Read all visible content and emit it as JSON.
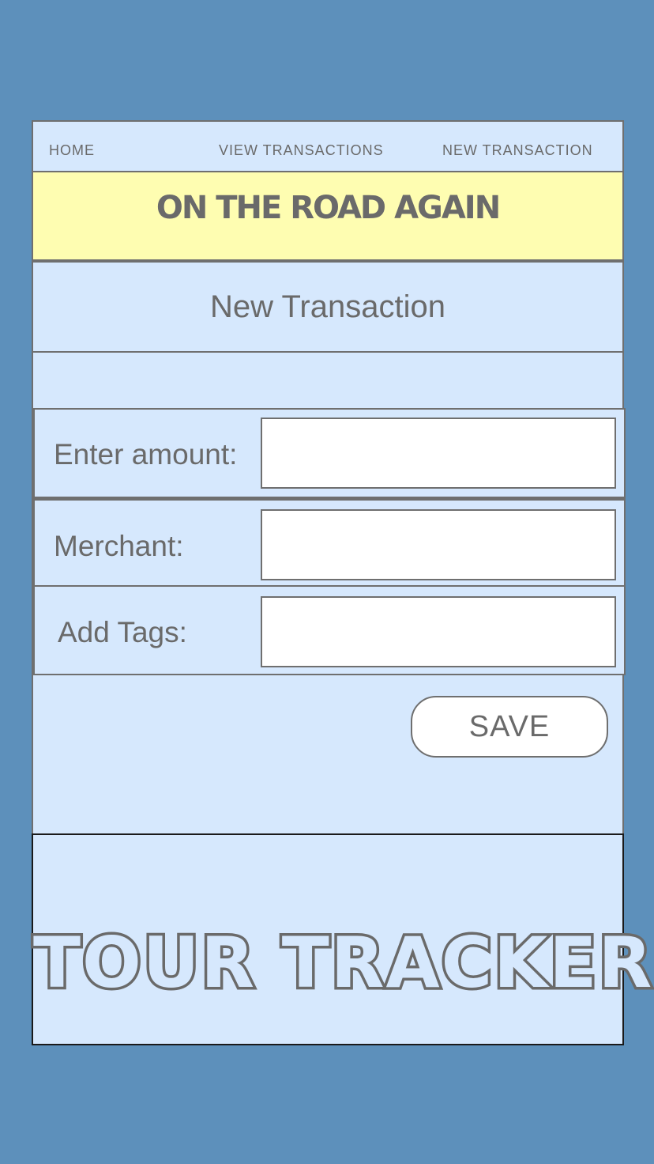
{
  "nav": {
    "home": "HOME",
    "view_transactions": "VIEW TRANSACTIONS",
    "new_transaction": "NEW TRANSACTION"
  },
  "banner": {
    "title": "ON THE ROAD AGAIN"
  },
  "page": {
    "title": "New Transaction"
  },
  "form": {
    "amount_label": "Enter amount:",
    "amount_value": "",
    "merchant_label": "Merchant:",
    "merchant_value": "",
    "tags_label": "Add Tags:",
    "tags_value": "",
    "save_label": "SAVE"
  },
  "footer": {
    "brand": "TOUR TRACKER"
  },
  "colors": {
    "background": "#5d90bb",
    "panel": "#d6e8fd",
    "banner": "#fefdb1",
    "text": "#6a6a6a"
  }
}
